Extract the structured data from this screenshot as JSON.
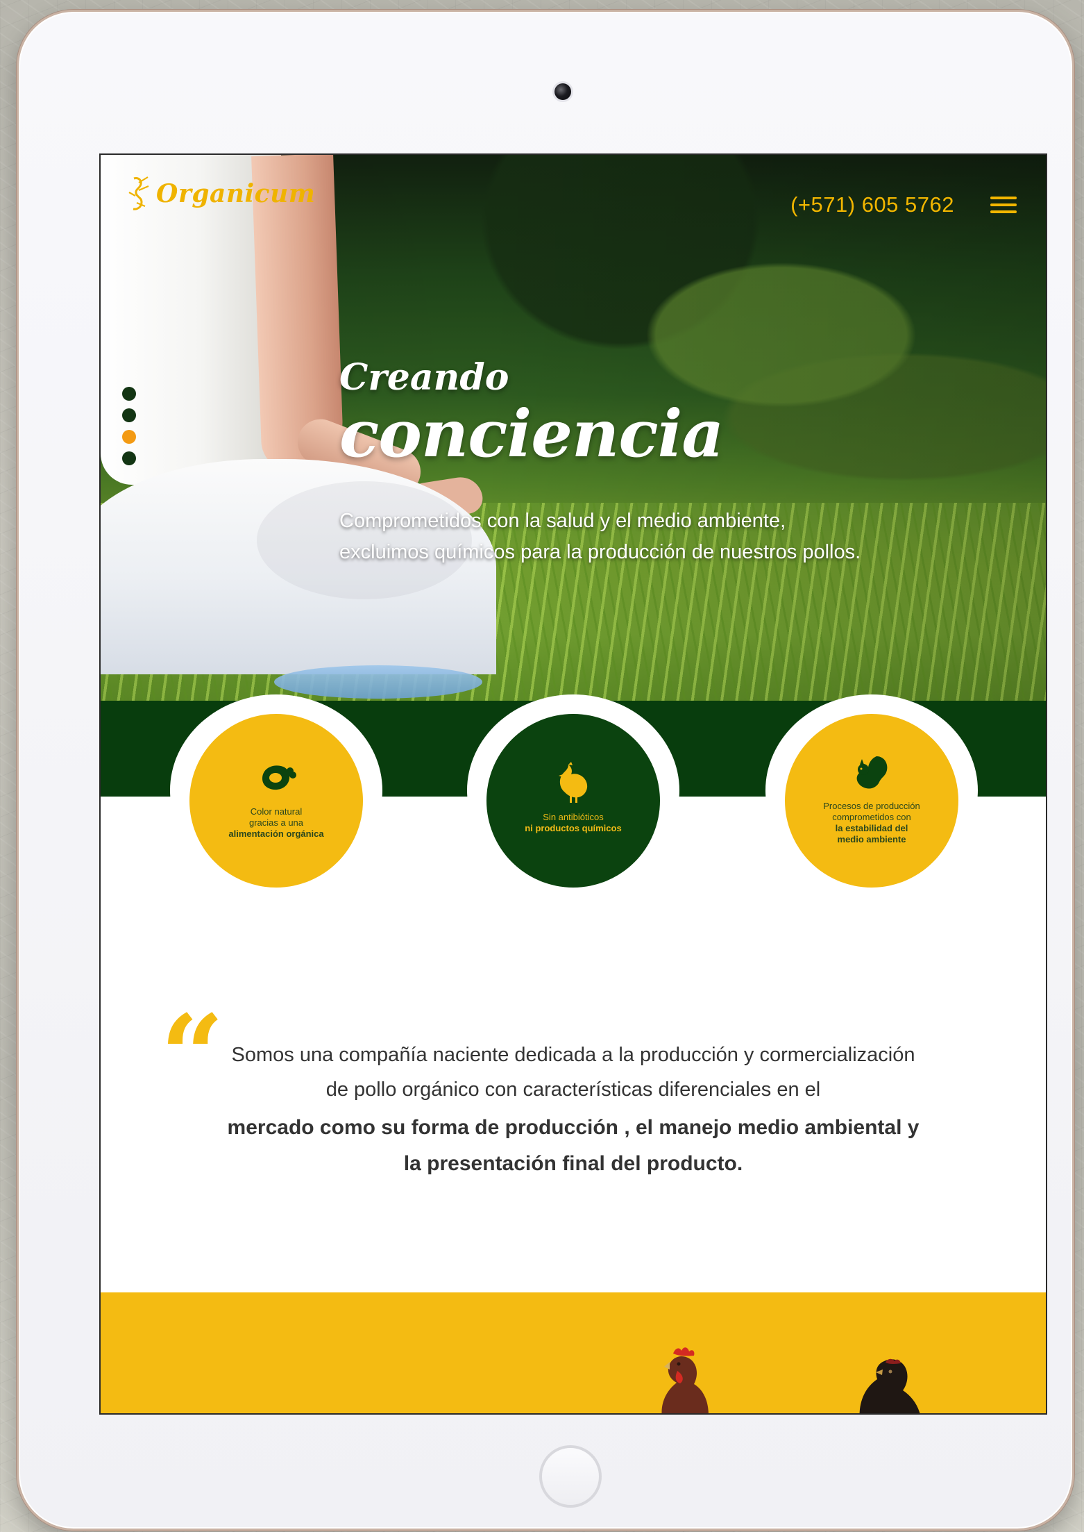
{
  "site": {
    "logo_text": "Organicum",
    "phone": "(+571) 605 5762"
  },
  "hero": {
    "title_small": "Creando",
    "title_big": "conciencia",
    "text_line_1": "Comprometidos con la salud y el medio ambiente,",
    "text_line_2": "excluimos químicos para la producción de nuestros pollos."
  },
  "slider": {
    "dots": 4,
    "active_index": 3
  },
  "features": [
    {
      "icon": "meat-leg-icon",
      "style": "gold",
      "line_1": "Color natural",
      "line_2": "gracias a una",
      "line_3": "alimentación orgánica"
    },
    {
      "icon": "chicken-icon",
      "style": "green",
      "line_1": "Sin antibióticos",
      "line_2": "ni productos químicos",
      "line_3": ""
    },
    {
      "icon": "squirrel-icon",
      "style": "gold",
      "line_1": "Procesos de producción",
      "line_2": "comprometidos con",
      "line_3": "la estabilidad del",
      "line_4": "medio ambiente"
    }
  ],
  "intro": {
    "line_1": "Somos una compañía naciente dedicada a la producción y cormercialización",
    "line_2": "de pollo orgánico con características diferenciales en el",
    "line_3": "mercado como su forma de producción , el manejo medio ambiental y",
    "line_4": "la presentación final del producto."
  },
  "colors": {
    "gold": "#f4bb12",
    "green": "#0b430f",
    "orange": "#f39a13"
  }
}
